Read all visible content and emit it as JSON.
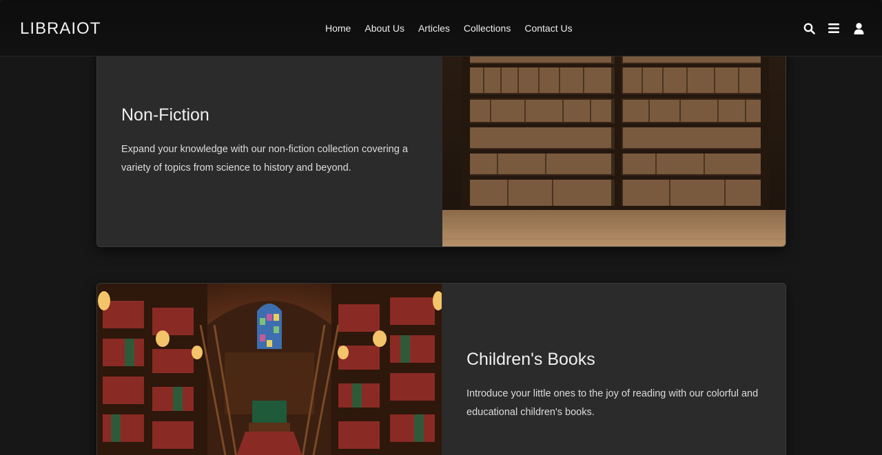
{
  "header": {
    "brand": "LIBRAIOT",
    "nav": [
      "Home",
      "About Us",
      "Articles",
      "Collections",
      "Contact Us"
    ],
    "icons": [
      "search-icon",
      "menu-icon",
      "user-icon"
    ]
  },
  "collections": [
    {
      "title": "Non-Fiction",
      "description": "Expand your knowledge with our non-fiction collection covering a variety of topics from science to history and beyond.",
      "image": "bookshelf-image"
    },
    {
      "title": "Children's Books",
      "description": "Introduce your little ones to the joy of reading with our colorful and educational children's books.",
      "image": "library-hall-image"
    }
  ],
  "colors": {
    "background": "#171717",
    "header": "#0d0d0d",
    "card": "#2b2b2b",
    "text": "#efefef"
  }
}
